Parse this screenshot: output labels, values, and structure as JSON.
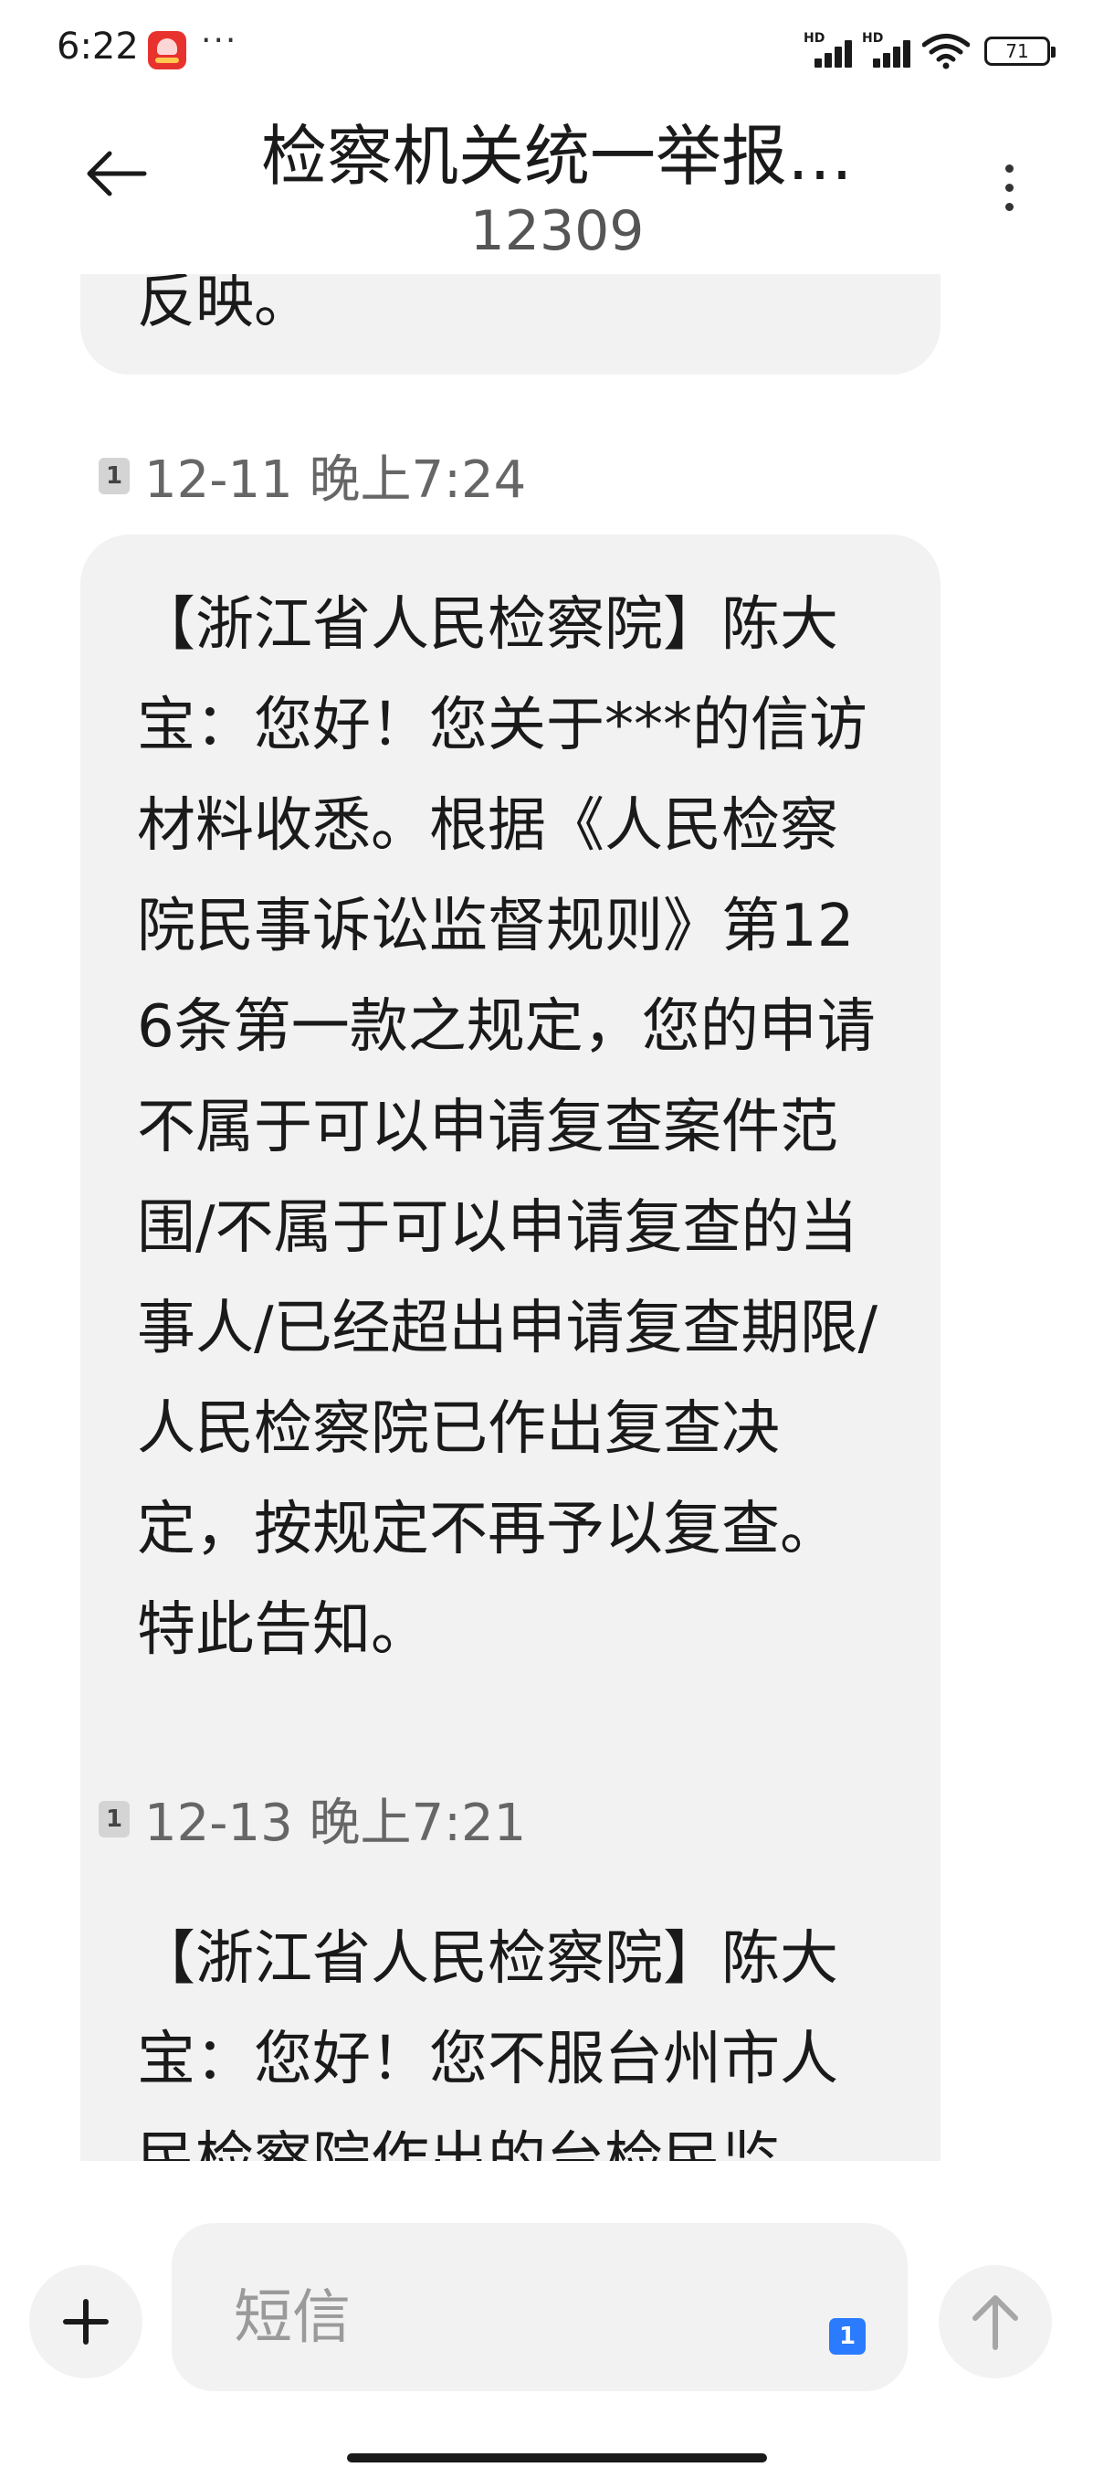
{
  "status_bar": {
    "time": "6:22",
    "app_icon": "shopping-app-icon",
    "more": "···",
    "signal_1_label": "HD",
    "signal_2_label": "HD",
    "battery": "71"
  },
  "header": {
    "title": "检察机关统一举报…",
    "subtitle": "12309",
    "back_icon": "back-arrow-icon",
    "menu_icon": "more-vertical-icon"
  },
  "messages": [
    {
      "text": "反映。"
    },
    {
      "sim": "1",
      "timestamp": "12-11 晚上7:24",
      "text": "【浙江省人民检察院】陈大宝：您好！您关于***的信访材料收悉。根据《人民检察院民事诉讼监督规则》第126条第一款之规定，您的申请不属于可以申请复查案件范围/不属于可以申请复查的当事人/已经超出申请复查期限/人民检察院已作出复查决定，按规定不再予以复查。特此告知。"
    },
    {
      "sim": "1",
      "timestamp": "12-13 晚上7:21",
      "text": "【浙江省人民检察院】陈大宝：您好！您不服台州市人民检察院作出的台检民监"
    }
  ],
  "composer": {
    "placeholder": "短信",
    "sim": "1",
    "plus_icon": "plus-icon",
    "send_icon": "send-arrow-icon"
  }
}
